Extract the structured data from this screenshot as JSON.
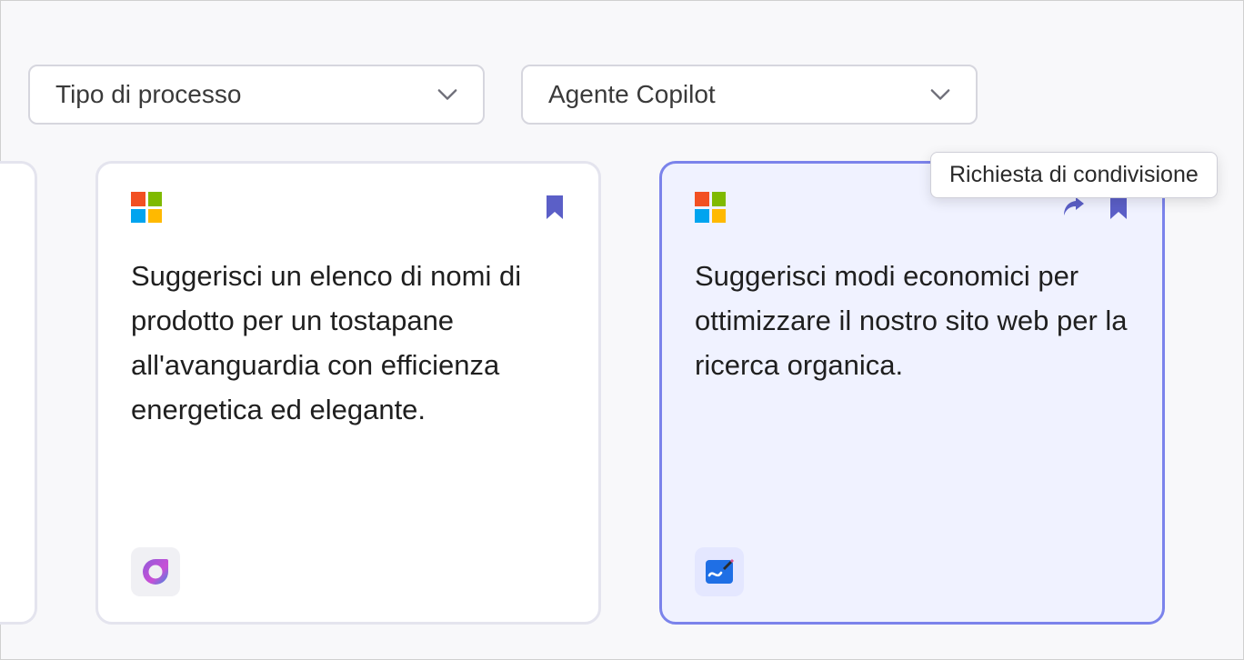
{
  "filters": {
    "process_type": {
      "label": "Tipo di processo"
    },
    "copilot_agent": {
      "label": "Agente Copilot"
    }
  },
  "tooltip": {
    "text": "Richiesta di condivisione"
  },
  "cards": [
    {
      "text": "Suggerisci un elenco di nomi di prodotto per un tostapane all'avanguardia con efficienza energetica ed elegante.",
      "app_icon": "loop",
      "bookmark_color": "#5b5fc7"
    },
    {
      "text": "Suggerisci modi economici per ottimizzare il nostro sito web per la ricerca organica.",
      "app_icon": "whiteboard",
      "bookmark_color": "#5b5fc7",
      "selected": true,
      "show_share": true
    }
  ]
}
